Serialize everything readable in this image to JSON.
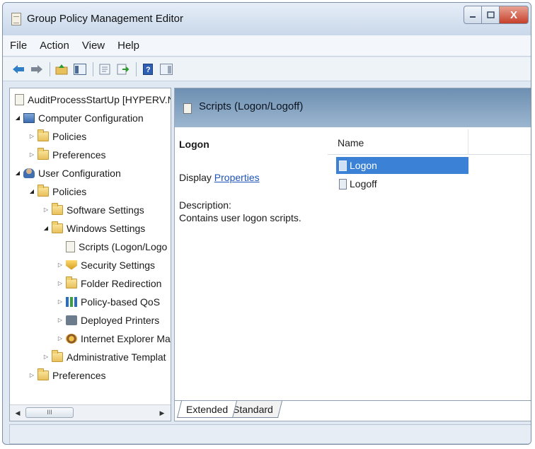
{
  "window": {
    "title": "Group Policy Management Editor"
  },
  "window_controls": {
    "close_glyph": "X"
  },
  "menu": [
    "File",
    "Action",
    "View",
    "Help"
  ],
  "tree": {
    "root": "AuditProcessStartUp [HYPERV.NW",
    "computer_configuration": "Computer Configuration",
    "cc_policies": "Policies",
    "cc_preferences": "Preferences",
    "user_configuration": "User Configuration",
    "uc_policies": "Policies",
    "software_settings": "Software Settings",
    "windows_settings": "Windows Settings",
    "scripts": "Scripts (Logon/Logo",
    "security_settings": "Security Settings",
    "folder_redirection": "Folder Redirection",
    "policy_qos": "Policy-based QoS",
    "deployed_printers": "Deployed Printers",
    "ie_maintenance": "Internet Explorer Ma",
    "admin_templates": "Administrative Templat",
    "uc_preferences": "Preferences"
  },
  "tree_scroll": {
    "thumb_glyph": "III"
  },
  "details": {
    "header": "Scripts (Logon/Logoff)",
    "extended": {
      "title": "Logon",
      "display_prefix": "Display ",
      "display_link": "Properties",
      "description_label": "Description:",
      "description_text": "Contains user logon scripts."
    },
    "list": {
      "column_name": "Name",
      "items": [
        {
          "label": "Logon",
          "selected": true
        },
        {
          "label": "Logoff",
          "selected": false
        }
      ]
    },
    "tabs": [
      "Extended",
      "Standard"
    ]
  },
  "colors": {
    "selection": "#3b82d6",
    "header_band": "#7f9fc0",
    "link": "#1d54b8",
    "close_button": "#c6402a"
  },
  "icons": {
    "toolbar": [
      "back-arrow-icon",
      "forward-arrow-icon",
      "up-folder-icon",
      "show-hide-tree-icon",
      "properties-icon",
      "export-list-icon",
      "help-icon",
      "show-hide-action-pane-icon"
    ]
  }
}
